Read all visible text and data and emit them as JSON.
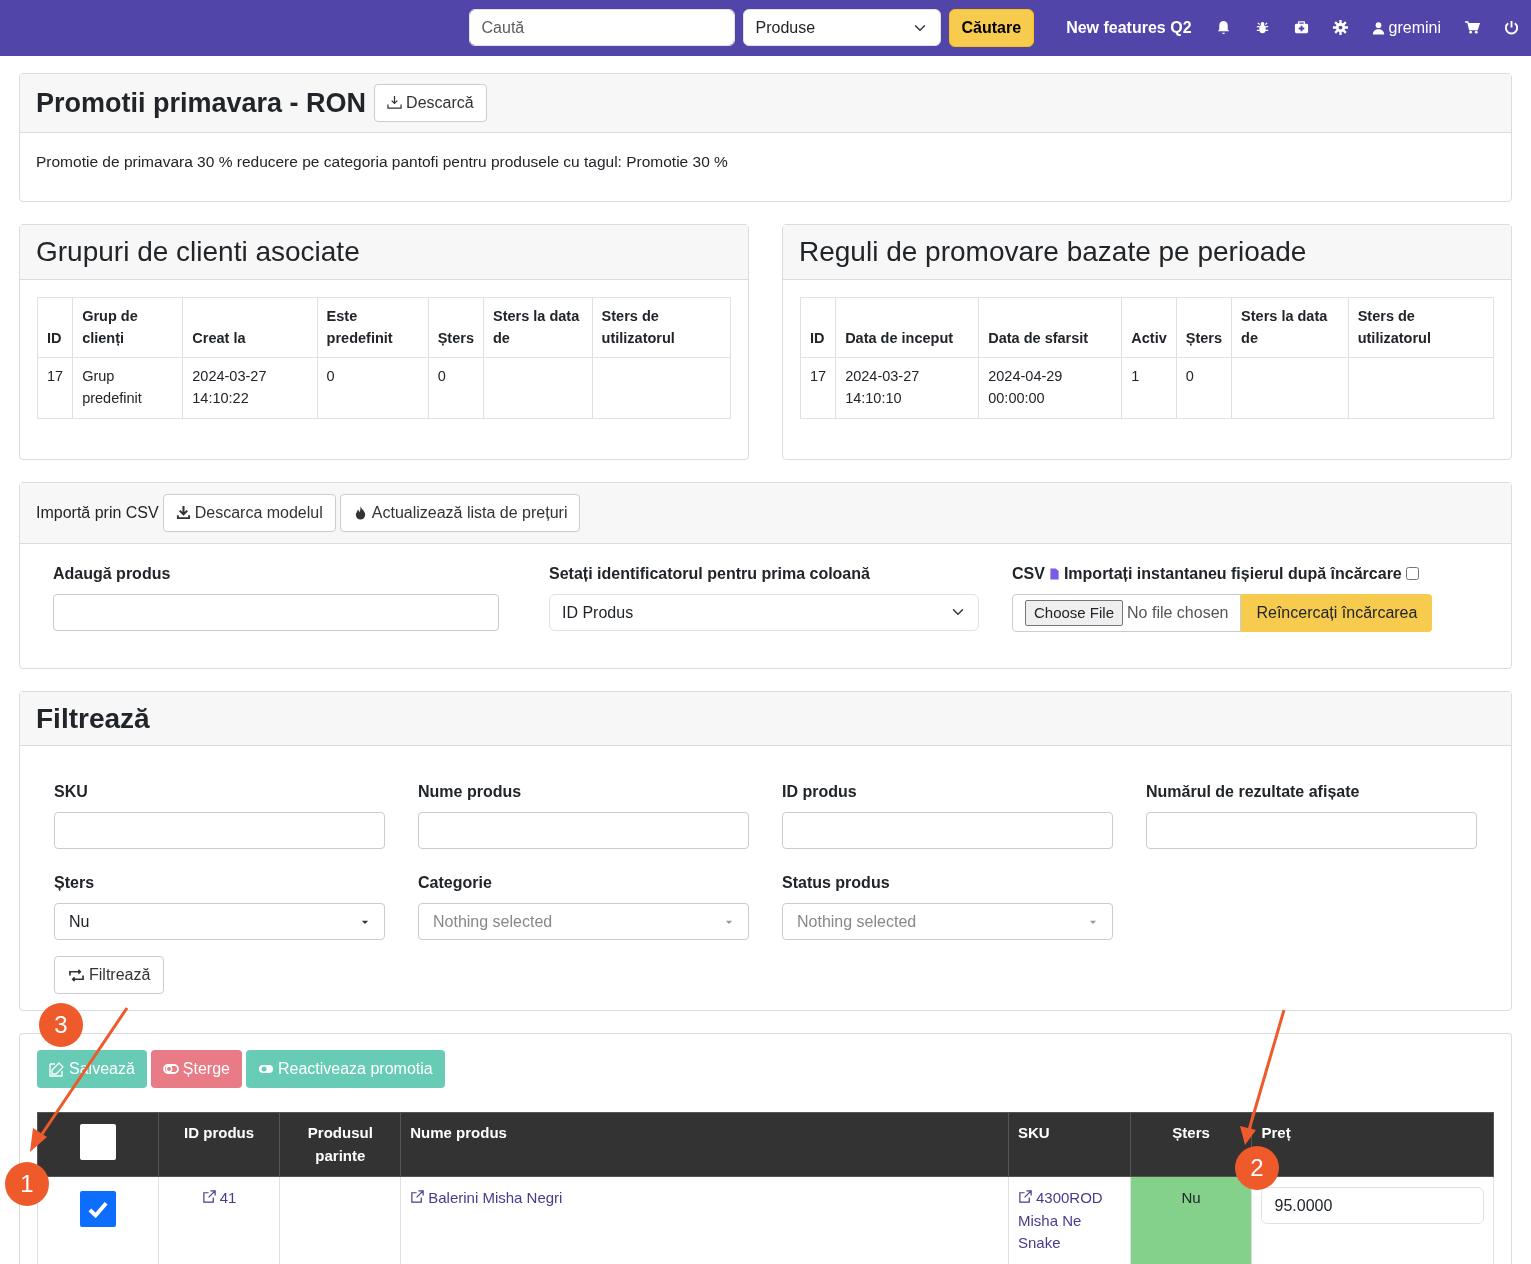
{
  "navbar": {
    "search_placeholder": "Caută",
    "category": "Produse",
    "search_button": "Căutare",
    "link": "New features Q2",
    "user": "gremini"
  },
  "promotion": {
    "title": "Promotii primavara - RON",
    "download_button": "Descarcă",
    "description": "Promotie de primavara 30 % reducere pe categoria pantofi pentru produsele cu tagul: Promotie 30 %"
  },
  "client_groups": {
    "title": "Grupuri de clienti asociate",
    "columns": [
      "ID",
      "Grup de clienți",
      "Creat la",
      "Este predefinit",
      "Șters",
      "Sters la data de",
      "Sters de utilizatorul"
    ],
    "rows": [
      [
        "17",
        "Grup predefinit",
        "2024-03-27 14:10:22",
        "0",
        "0",
        "",
        ""
      ]
    ]
  },
  "period_rules": {
    "title": "Reguli de promovare bazate pe perioade",
    "columns": [
      "ID",
      "Data de inceput",
      "Data de sfarsit",
      "Activ",
      "Șters",
      "Sters la data de",
      "Sters de utilizatorul"
    ],
    "rows": [
      [
        "17",
        "2024-03-27 14:10:10",
        "2024-04-29 00:00:00",
        "1",
        "0",
        "",
        ""
      ]
    ]
  },
  "csv_import": {
    "label": "Importă prin CSV",
    "buttons": [
      {
        "kind": "download",
        "label": "Descarca modelul"
      },
      {
        "kind": "fire",
        "label": "Actualizează lista de prețuri"
      }
    ],
    "add_product_label": "Adaugă produs",
    "identifier_label": "Setați identificatorul pentru prima coloană",
    "identifier_value": "ID Produs",
    "csv_label": "CSV",
    "instant_label": "Importați instantaneu fișierul după încărcare",
    "instant_checked": false,
    "file_button": "Choose File",
    "file_status": "No file chosen",
    "retry_button": "Reîncercați încărcarea"
  },
  "filter": {
    "title": "Filtrează",
    "fields": [
      {
        "kind": "input",
        "label": "SKU"
      },
      {
        "kind": "input",
        "label": "Nume produs"
      },
      {
        "kind": "input",
        "label": "ID produs"
      },
      {
        "kind": "input",
        "label": "Numărul de rezultate afișate"
      },
      {
        "kind": "select",
        "label": "Șters",
        "value": "Nu"
      },
      {
        "kind": "select",
        "label": "Categorie",
        "placeholder": "Nothing selected"
      },
      {
        "kind": "select",
        "label": "Status produs",
        "placeholder": "Nothing selected"
      }
    ],
    "button": "Filtrează"
  },
  "products": {
    "buttons": [
      {
        "kind": "save",
        "label": "Salvează"
      },
      {
        "kind": "delete",
        "label": "Șterge"
      },
      {
        "kind": "reactivate",
        "label": "Reactiveaza promotia"
      }
    ],
    "select_all_checked": false,
    "columns": [
      "ID produs",
      "Produsul parinte",
      "Nume produs",
      "SKU",
      "Șters",
      "Preț"
    ],
    "rows": [
      {
        "selected": true,
        "id": "41",
        "parent": "",
        "name": "Balerini Misha Negri",
        "sku": "4300ROD Misha Ne Snake",
        "deleted": "Nu",
        "price": "95.0000"
      }
    ]
  },
  "annotations": [
    "1",
    "2",
    "3"
  ]
}
